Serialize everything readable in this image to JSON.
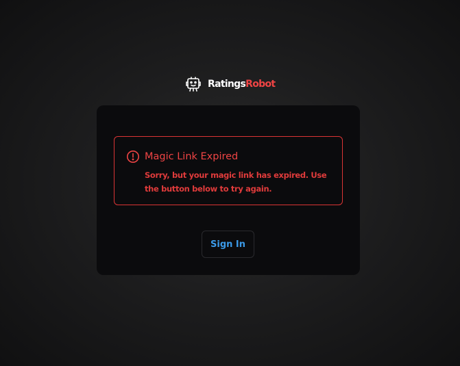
{
  "brand": {
    "name_part1": "Ratings",
    "name_part2": "Robot",
    "logo_icon": "robot-head-icon",
    "accent_color": "#ef4444"
  },
  "alert": {
    "icon": "exclamation-circle-icon",
    "title": "Magic Link Expired",
    "message": "Sorry, but your magic link has expired. Use the button below to try again.",
    "color": "#ef4444"
  },
  "actions": {
    "sign_in_label": "Sign In",
    "link_color": "#3b9ae8"
  }
}
